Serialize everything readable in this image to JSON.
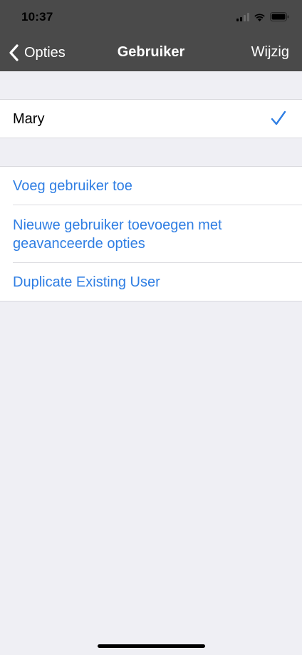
{
  "status_bar": {
    "time": "10:37",
    "icons": [
      "signal-icon",
      "wifi-icon",
      "battery-icon"
    ]
  },
  "nav": {
    "back_label": "Opties",
    "title": "Gebruiker",
    "right_label": "Wijzig"
  },
  "users": [
    {
      "name": "Mary",
      "selected": true
    }
  ],
  "actions": [
    {
      "label": "Voeg gebruiker toe"
    },
    {
      "label": "Nieuwe gebruiker toevoegen met geavanceerde opties"
    },
    {
      "label": "Duplicate Existing User"
    }
  ],
  "colors": {
    "nav_background": "#4a4a4a",
    "accent": "#2f7ee3",
    "background": "#efeff4"
  }
}
